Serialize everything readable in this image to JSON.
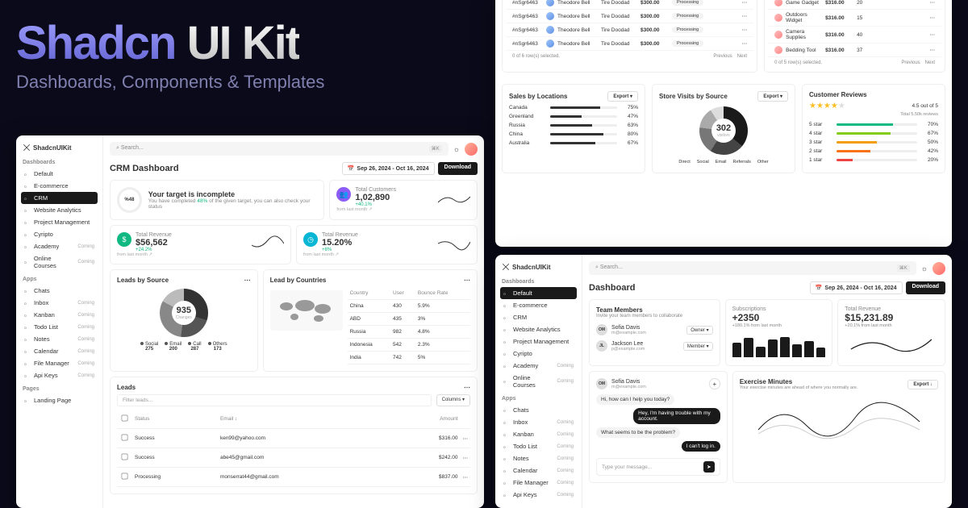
{
  "hero": {
    "brand": "Shadcn",
    "product": " UI Kit",
    "subtitle": "Dashboards, Components & Templates"
  },
  "app": {
    "name": "ShadcnUIKit",
    "search_ph": "Search...",
    "kbd": "⌘K"
  },
  "daterange": "Sep 26, 2024 - Oct 16, 2024",
  "download": "Download",
  "sidebar": {
    "sec_dashboards": "Dashboards",
    "sec_apps": "Apps",
    "sec_pages": "Pages",
    "dashboards": [
      {
        "label": "Default"
      },
      {
        "label": "E-commerce"
      },
      {
        "label": "CRM"
      },
      {
        "label": "Website Analytics"
      },
      {
        "label": "Project Management"
      },
      {
        "label": "Cyripto"
      },
      {
        "label": "Academy",
        "badge": "Coming"
      },
      {
        "label": "Online Courses",
        "badge": "Coming"
      }
    ],
    "apps": [
      {
        "label": "Chats"
      },
      {
        "label": "Inbox",
        "badge": "Coming"
      },
      {
        "label": "Kanban",
        "badge": "Coming"
      },
      {
        "label": "Todo List",
        "badge": "Coming"
      },
      {
        "label": "Notes",
        "badge": "Coming"
      },
      {
        "label": "Calendar",
        "badge": "Coming"
      },
      {
        "label": "File Manager",
        "badge": "Coming"
      },
      {
        "label": "Api Keys",
        "badge": "Coming"
      }
    ],
    "pages": [
      {
        "label": "Landing Page"
      }
    ]
  },
  "crm": {
    "title": "CRM Dashboard",
    "target_title": "Your target is incomplete",
    "target_desc1": "You have completed ",
    "target_pct": "48%",
    "target_desc2": " of the given target, you can also check your status",
    "ring_pct": "%48",
    "stats": {
      "customers": {
        "label": "Total Customers",
        "value": "1,02,890",
        "delta": "+40.1%",
        "from": "from last month ↗"
      },
      "revenue": {
        "label": "Total Revenue",
        "value": "$56,562",
        "delta": "+24.2%",
        "from": "from last month ↗"
      },
      "rate": {
        "label": "Total Revenue",
        "value": "15.20%",
        "delta": "+8%",
        "from": "from last month ↗"
      }
    },
    "leads_source": {
      "title": "Leads by Source",
      "total": "935",
      "sub": "Changes",
      "items": [
        {
          "name": "Social",
          "val": "275"
        },
        {
          "name": "Email",
          "val": "200"
        },
        {
          "name": "Call",
          "val": "287"
        },
        {
          "name": "Others",
          "val": "173"
        }
      ]
    },
    "leads_country": {
      "title": "Lead by Countries",
      "h_country": "Country",
      "h_user": "User",
      "h_bounce": "Bounce Rate",
      "rows": [
        {
          "c": "China",
          "u": "430",
          "b": "5.9%"
        },
        {
          "c": "ABD",
          "u": "435",
          "b": "3%"
        },
        {
          "c": "Russia",
          "u": "982",
          "b": "4.8%"
        },
        {
          "c": "Indonesia",
          "u": "542",
          "b": "2.3%"
        },
        {
          "c": "India",
          "u": "742",
          "b": "5%"
        }
      ]
    },
    "leads_table": {
      "title": "Leads",
      "filter_ph": "Filter leads...",
      "columns": "Columns ▾",
      "h_status": "Status",
      "h_email": "Email ↕",
      "h_amount": "Amount",
      "rows": [
        {
          "s": "Success",
          "e": "ken99@yahoo.com",
          "a": "$316.00"
        },
        {
          "s": "Success",
          "e": "abe45@gmail.com",
          "a": "$242.00"
        },
        {
          "s": "Processing",
          "e": "monserrat44@gmail.com",
          "a": "$837.00"
        }
      ]
    }
  },
  "default": {
    "title": "Dashboard",
    "team": {
      "title": "Team Members",
      "sub": "Invite your team members to collaborate",
      "members": [
        {
          "ini": "OM",
          "name": "Sofia Davis",
          "email": "m@example.com",
          "role": "Owner ▾"
        },
        {
          "ini": "JL",
          "name": "Jackson Lee",
          "email": "p@example.com",
          "role": "Member ▾"
        }
      ]
    },
    "subs": {
      "title": "Subscriptions",
      "value": "+2350",
      "delta": "+180.1% from last month"
    },
    "rev": {
      "title": "Total Revenue",
      "value": "$15,231.89",
      "delta": "+20.1% from last month"
    },
    "chat": {
      "from": {
        "ini": "OM",
        "name": "Sofia Davis",
        "email": "m@example.com"
      },
      "plus": "+",
      "msgs": [
        {
          "who": "l",
          "t": "Hi, how can I help you today?"
        },
        {
          "who": "r",
          "t": "Hey, I'm having trouble with my account."
        },
        {
          "who": "l",
          "t": "What seems to be the problem?"
        },
        {
          "who": "r",
          "t": "I can't log in."
        }
      ],
      "input_ph": "Type your message..."
    },
    "exercise": {
      "title": "Exercise Minutes",
      "sub": "Your exercise minutes are ahead of where you normally are.",
      "export": "Export ↓"
    }
  },
  "ecom": {
    "orders": {
      "rows": [
        {
          "id": "#nSgr6463",
          "cust": "Theodore Bell",
          "prod": "Tire Doodad",
          "amt": "$300.00",
          "st": "Processing"
        },
        {
          "id": "#nSgr6463",
          "cust": "Theodore Bell",
          "prod": "Tire Doodad",
          "amt": "$300.00",
          "st": "Processing"
        },
        {
          "id": "#nSgr6463",
          "cust": "Theodore Bell",
          "prod": "Tire Doodad",
          "amt": "$300.00",
          "st": "Processing"
        },
        {
          "id": "#nSgr6463",
          "cust": "Theodore Bell",
          "prod": "Tire Doodad",
          "amt": "$300.00",
          "st": "Processing"
        }
      ],
      "sel": "0 of 6 row(s) selected.",
      "prev": "Previous",
      "next": "Next"
    },
    "products": {
      "rows": [
        {
          "name": "Game Gadget",
          "price": "$316.00",
          "qty": "20"
        },
        {
          "name": "Outdoors Widget",
          "price": "$316.00",
          "qty": "15"
        },
        {
          "name": "Camera Supplies",
          "price": "$316.00",
          "qty": "40"
        },
        {
          "name": "Bedding Tool",
          "price": "$316.00",
          "qty": "37"
        }
      ],
      "sel": "0 of 5 row(s) selected.",
      "prev": "Previous",
      "next": "Next"
    },
    "locations": {
      "title": "Sales by Locations",
      "export": "Export ▾",
      "rows": [
        {
          "c": "Canada",
          "p": 75
        },
        {
          "c": "Greenland",
          "p": 47
        },
        {
          "c": "Russia",
          "p": 63
        },
        {
          "c": "China",
          "p": 80
        },
        {
          "c": "Australia",
          "p": 67
        }
      ]
    },
    "visits": {
      "title": "Store Visits by Source",
      "export": "Export ▾",
      "total": "302",
      "sub": "visitors",
      "legend": [
        "Direct",
        "Social",
        "Email",
        "Referrals",
        "Other"
      ]
    },
    "reviews": {
      "title": "Customer Reviews",
      "score": "4.5 out of 5",
      "total": "Total 5.50k reviews",
      "bars": [
        {
          "l": "5 star",
          "p": 70,
          "c": "#10b981"
        },
        {
          "l": "4 star",
          "p": 67,
          "c": "#84cc16"
        },
        {
          "l": "3 star",
          "p": 50,
          "c": "#f59e0b"
        },
        {
          "l": "2 star",
          "p": 42,
          "c": "#f97316"
        },
        {
          "l": "1 star",
          "p": 20,
          "c": "#ef4444"
        }
      ]
    }
  },
  "chart_data": [
    {
      "type": "bar",
      "title": "Sales by Locations",
      "categories": [
        "Canada",
        "Greenland",
        "Russia",
        "China",
        "Australia"
      ],
      "values": [
        75,
        47,
        63,
        80,
        67
      ],
      "ylim": [
        0,
        100
      ]
    },
    {
      "type": "bar",
      "title": "Customer Reviews",
      "categories": [
        "5 star",
        "4 star",
        "3 star",
        "2 star",
        "1 star"
      ],
      "values": [
        70,
        67,
        50,
        42,
        20
      ],
      "ylim": [
        0,
        100
      ]
    },
    {
      "type": "pie",
      "title": "Leads by Source",
      "series": [
        {
          "name": "Social",
          "value": 275
        },
        {
          "name": "Email",
          "value": 200
        },
        {
          "name": "Call",
          "value": 287
        },
        {
          "name": "Others",
          "value": 173
        }
      ],
      "total": 935
    },
    {
      "type": "pie",
      "title": "Store Visits by Source",
      "series": [
        {
          "name": "Direct",
          "value": 110
        },
        {
          "name": "Social",
          "value": 70
        },
        {
          "name": "Email",
          "value": 55
        },
        {
          "name": "Referrals",
          "value": 40
        },
        {
          "name": "Other",
          "value": 27
        }
      ],
      "total": 302
    },
    {
      "type": "bar",
      "title": "Subscriptions",
      "categories": [
        "1",
        "2",
        "3",
        "4",
        "5",
        "6",
        "7",
        "8"
      ],
      "values": [
        18,
        24,
        14,
        22,
        26,
        16,
        20,
        12
      ]
    }
  ]
}
